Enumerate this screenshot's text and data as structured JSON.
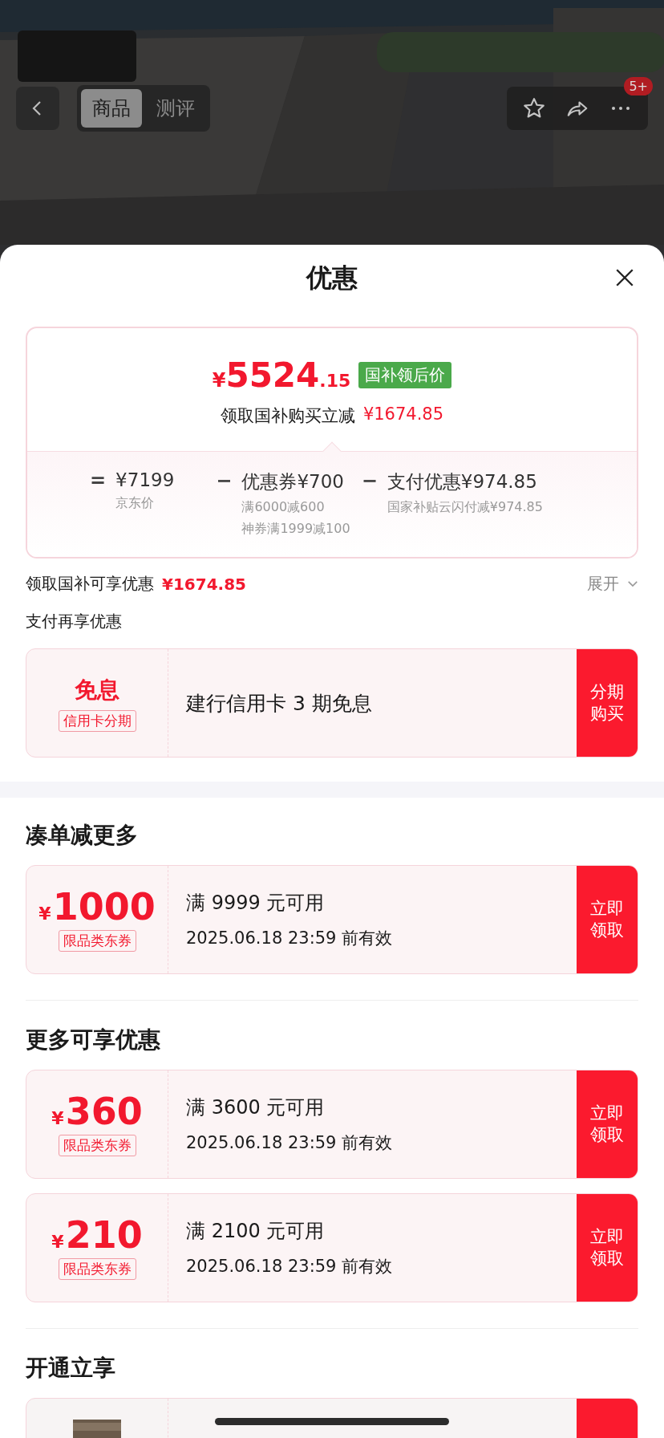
{
  "nav": {
    "tabs": [
      {
        "label": "商品",
        "selected": true
      },
      {
        "label": "测评",
        "selected": false
      }
    ],
    "badge": "5+"
  },
  "sheet": {
    "title": "优惠"
  },
  "price_card": {
    "currency": "¥",
    "integer": "5524",
    "decimal": ".15",
    "tag": "国补领后价",
    "subtitle": "领取国补购买立减",
    "subtitle_amount": "¥1674.85",
    "breakdown": [
      {
        "operator": "=",
        "label": "¥7199",
        "notes": [
          "京东价"
        ]
      },
      {
        "operator": "−",
        "label": "优惠券¥700",
        "notes": [
          "满6000减600",
          "神券满1999减100"
        ]
      },
      {
        "operator": "−",
        "label": "支付优惠¥974.85",
        "notes": [
          "国家补贴云闪付减¥974.85"
        ]
      }
    ]
  },
  "subsidy_row": {
    "label": "领取国补可享优惠",
    "amount": "¥1674.85",
    "toggle": "展开"
  },
  "payment": {
    "heading": "支付再享优惠",
    "offer": {
      "title": "免息",
      "tag": "信用卡分期",
      "text": "建行信用卡 3 期免息",
      "button": "分期购买"
    }
  },
  "sections": [
    {
      "heading": "凑单减更多",
      "items": [
        {
          "kind": "coupon",
          "currency": "¥",
          "amount": "1000",
          "tag": "限品类东券",
          "condition": "满 9999 元可用",
          "validity": "2025.06.18 23:59 前有效",
          "button": "立即领取"
        }
      ]
    },
    {
      "heading": "更多可享优惠",
      "items": [
        {
          "kind": "coupon",
          "currency": "¥",
          "amount": "360",
          "tag": "限品类东券",
          "condition": "满 3600 元可用",
          "validity": "2025.06.18 23:59 前有效",
          "button": "立即领取"
        },
        {
          "kind": "coupon",
          "currency": "¥",
          "amount": "210",
          "tag": "限品类东券",
          "condition": "满 2100 元可用",
          "validity": "2025.06.18 23:59 前有效",
          "button": "立即领取"
        }
      ]
    },
    {
      "heading": "开通立享",
      "items": [
        {
          "kind": "membership"
        }
      ]
    }
  ]
}
